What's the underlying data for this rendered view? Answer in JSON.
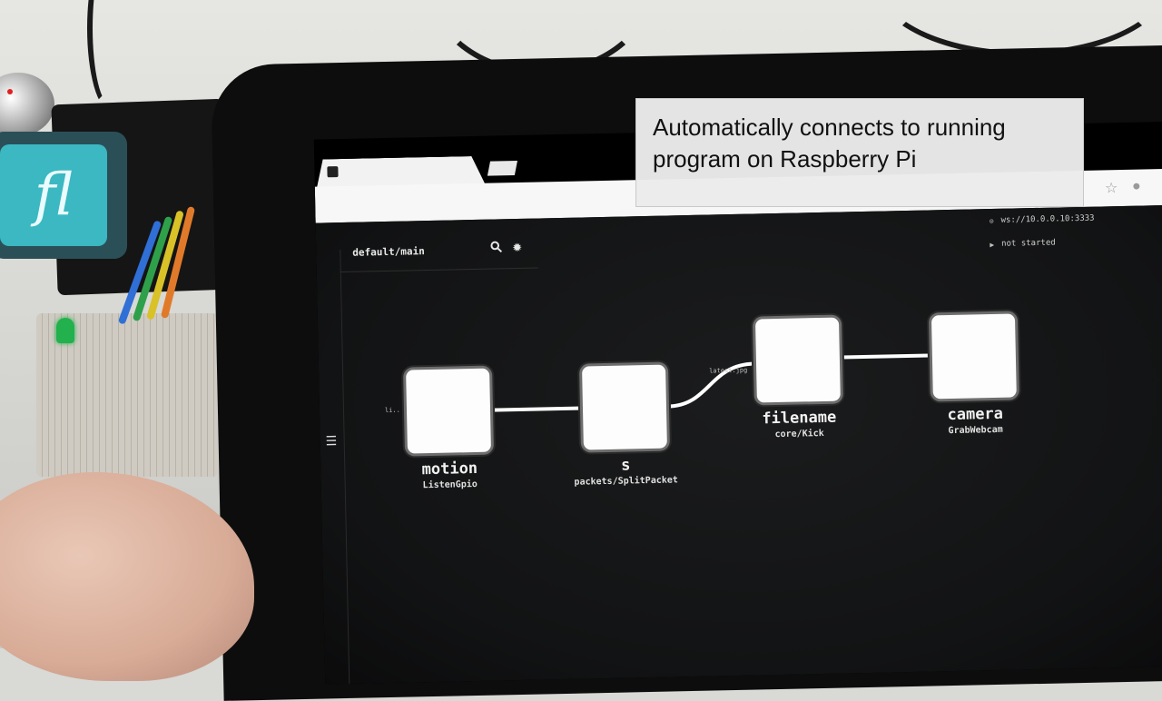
{
  "caption": {
    "line1": "Automatically connects to running",
    "line2": "program on Raspberry Pi"
  },
  "device": {
    "badge_text": "fl"
  },
  "browser": {
    "star_icon": "star-icon",
    "mic_icon": "mic-icon"
  },
  "graph": {
    "title": "default/main",
    "search_icon": "search-icon",
    "settings_icon": "gear-icon",
    "menu_icon": "list-icon"
  },
  "runtime": {
    "address": "ws://10.0.0.10:3333",
    "status": "not started"
  },
  "nodes": [
    {
      "name": "motion",
      "component": "ListenGpio"
    },
    {
      "name": "s",
      "component": "packets/SplitPacket"
    },
    {
      "name": "filename",
      "component": "core/Kick"
    },
    {
      "name": "camera",
      "component": "GrabWebcam"
    }
  ],
  "ports": {
    "motion_out": "li..",
    "filename_in": "latest.jpg"
  },
  "colors": {
    "caption_bg": "#ebebeb",
    "app_bg": "#121314",
    "node_fill": "#fdfdfd",
    "edge": "#ffffff",
    "badge": "#3bb8c1"
  }
}
